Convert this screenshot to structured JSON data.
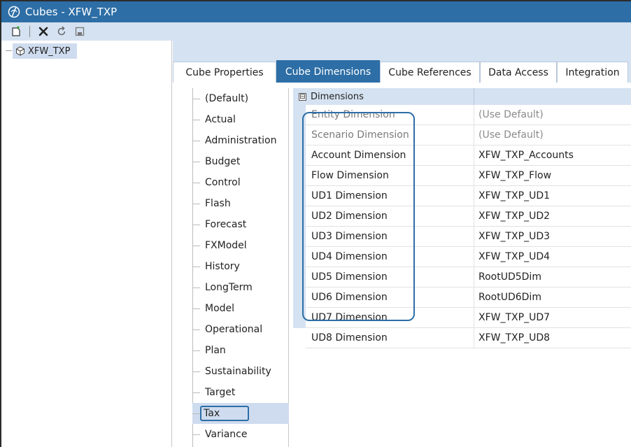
{
  "window": {
    "title": "Cubes - XFW_TXP"
  },
  "toolbar": {
    "buttons": [
      {
        "name": "new-icon"
      },
      {
        "name": "delete-icon"
      },
      {
        "name": "refresh-icon"
      },
      {
        "name": "save-icon"
      }
    ]
  },
  "tree": {
    "root_label": "XFW_TXP"
  },
  "tabs": [
    {
      "label": "Cube Properties",
      "active": false
    },
    {
      "label": "Cube Dimensions",
      "active": true
    },
    {
      "label": "Cube References",
      "active": false
    },
    {
      "label": "Data Access",
      "active": false
    },
    {
      "label": "Integration",
      "active": false
    }
  ],
  "scenario_types": [
    "(Default)",
    "Actual",
    "Administration",
    "Budget",
    "Control",
    "Flash",
    "Forecast",
    "FXModel",
    "History",
    "LongTerm",
    "Model",
    "Operational",
    "Plan",
    "Sustainability",
    "Target",
    "Tax",
    "Variance"
  ],
  "selected_scenario_type": "Tax",
  "grid": {
    "group_label": "Dimensions",
    "toggle_symbol": "⊟",
    "rows": [
      {
        "key": "Entity Dimension",
        "value": "(Use Default)",
        "dim": true
      },
      {
        "key": "Scenario Dimension",
        "value": "(Use Default)",
        "dim": true
      },
      {
        "key": "Account Dimension",
        "value": "XFW_TXP_Accounts",
        "dim": false
      },
      {
        "key": "Flow Dimension",
        "value": "XFW_TXP_Flow",
        "dim": false
      },
      {
        "key": "UD1 Dimension",
        "value": "XFW_TXP_UD1",
        "dim": false
      },
      {
        "key": "UD2 Dimension",
        "value": "XFW_TXP_UD2",
        "dim": false
      },
      {
        "key": "UD3 Dimension",
        "value": "XFW_TXP_UD3",
        "dim": false
      },
      {
        "key": "UD4 Dimension",
        "value": "XFW_TXP_UD4",
        "dim": false
      },
      {
        "key": "UD5 Dimension",
        "value": "RootUD5Dim",
        "dim": false
      },
      {
        "key": "UD6 Dimension",
        "value": "RootUD6Dim",
        "dim": false
      },
      {
        "key": "UD7 Dimension",
        "value": "XFW_TXP_UD7",
        "dim": false
      },
      {
        "key": "UD8 Dimension",
        "value": "XFW_TXP_UD8",
        "dim": false
      }
    ]
  },
  "colors": {
    "accent": "#2d6ea6",
    "panel": "#d5e2f1",
    "selected": "#cfdcef"
  }
}
